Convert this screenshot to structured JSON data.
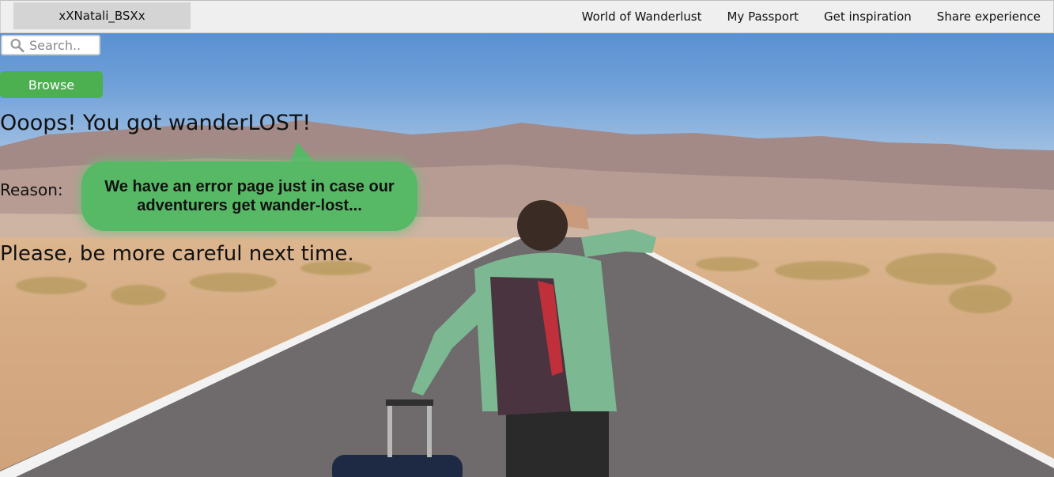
{
  "header": {
    "brand": "xXNatali_BSXx",
    "nav": [
      {
        "label": "World of Wanderlust"
      },
      {
        "label": "My Passport"
      },
      {
        "label": "Get inspiration"
      },
      {
        "label": "Share experience"
      }
    ]
  },
  "search": {
    "placeholder": "Search..",
    "icon": "search-icon"
  },
  "browse_label": "Browse",
  "error": {
    "headline": "Ooops! You got wanderLOST!",
    "reason_label": "Reason:",
    "reason_text": "We have an error page just in case our adventurers get wander-lost...",
    "closing": "Please, be more careful next time."
  },
  "colors": {
    "accent_green": "#4caf50",
    "bubble_green": "#57b866",
    "nav_background": "#efefef"
  }
}
